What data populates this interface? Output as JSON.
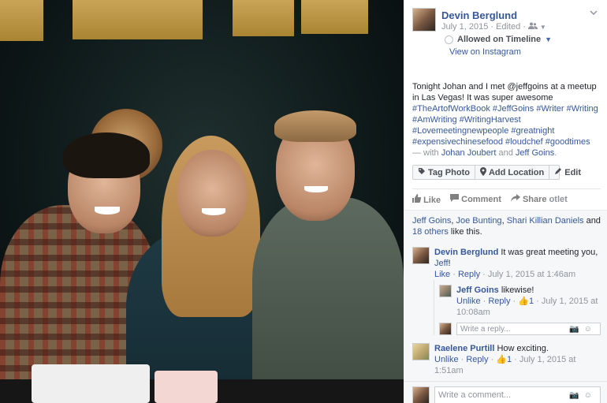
{
  "post": {
    "author": "Devin Berglund",
    "date": "July 1, 2015",
    "edited": "Edited",
    "audience_icon": "friends-icon",
    "timeline_label": "Allowed on Timeline",
    "view_source": "View on Instagram",
    "message": "Tonight Johan and I met @jeffgoins at a meetup in Las Vegas! It was super awesome",
    "hashtags": "#TheArtofWorkBook #JeffGoins #Writer #Writing #AmWriting #WritingHarvest #Lovemeetingnewpeople #greatnight #expensivechinesefood #loudchef #goodtimes",
    "with_prefix": " — with ",
    "with_person_1": "Johan Joubert",
    "with_and": " and ",
    "with_person_2": "Jeff Goins",
    "with_suffix": "."
  },
  "photo_actions": {
    "tag_photo": "Tag Photo",
    "add_location": "Add Location",
    "edit": "Edit"
  },
  "ufi": {
    "like": "Like",
    "comment": "Comment",
    "share": "Share",
    "share_overlay": "otlet"
  },
  "likes": {
    "name_1": "Jeff Goins",
    "name_2": "Joe Bunting",
    "name_3": "Shari Killian Daniels",
    "sep": ", ",
    "and": " and ",
    "others": "18 others",
    "suffix": " like this."
  },
  "comments": [
    {
      "author": "Devin Berglund",
      "text": " It was great meeting you, ",
      "mention": "Jeff",
      "mention_suffix": "!",
      "like": "Like",
      "reply": "Reply",
      "time": "July 1, 2015 at 1:46am"
    },
    {
      "author": "Jeff Goins",
      "text": " likewise!",
      "unlike": "Unlike",
      "reply": "Reply",
      "likes": "1",
      "time": "July 1, 2015 at 10:08am"
    },
    {
      "author": "Raelene Purtill",
      "text": " How exciting.",
      "unlike": "Unlike",
      "reply": "Reply",
      "likes": "1",
      "time": "July 1, 2015 at 1:51am"
    }
  ],
  "inputs": {
    "reply_placeholder": "Write a reply...",
    "comment_placeholder": "Write a comment..."
  },
  "colors": {
    "link": "#365899",
    "meta": "#90949c"
  }
}
